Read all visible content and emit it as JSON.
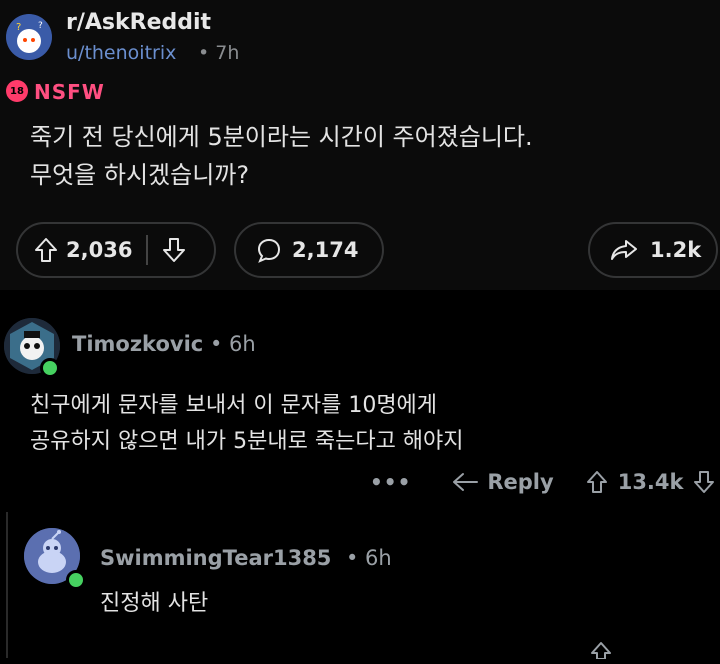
{
  "post": {
    "subreddit": "r/AskReddit",
    "author": "u/thenoitrix",
    "time": "• 7h",
    "nsfw_badge": "18",
    "nsfw_label": "NSFW",
    "title_line1": "죽기 전 당신에게 5분이라는 시간이 주어졌습니다.",
    "title_line2": "무엇을 하시겠습니까?",
    "upvotes": "2,036",
    "comments": "2,174",
    "shares": "1.2k"
  },
  "comment1": {
    "author": "Timozkovic",
    "time": "• 6h",
    "body_line1": "친구에게 문자를 보내서 이 문자를 10명에게",
    "body_line2": "공유하지 않으면 내가 5분내로 죽는다고 해야지",
    "more": "•••",
    "reply_label": "Reply",
    "score": "13.4k"
  },
  "comment2": {
    "author": "SwimmingTear1385",
    "time": "• 6h",
    "body": "진정해 사탄"
  },
  "colors": {
    "accent_nsfw": "#ff4f81",
    "author_link": "#6b8fcf",
    "online": "#46d160"
  },
  "icons": [
    "upvote-icon",
    "downvote-icon",
    "comment-icon",
    "share-icon",
    "reply-icon"
  ]
}
